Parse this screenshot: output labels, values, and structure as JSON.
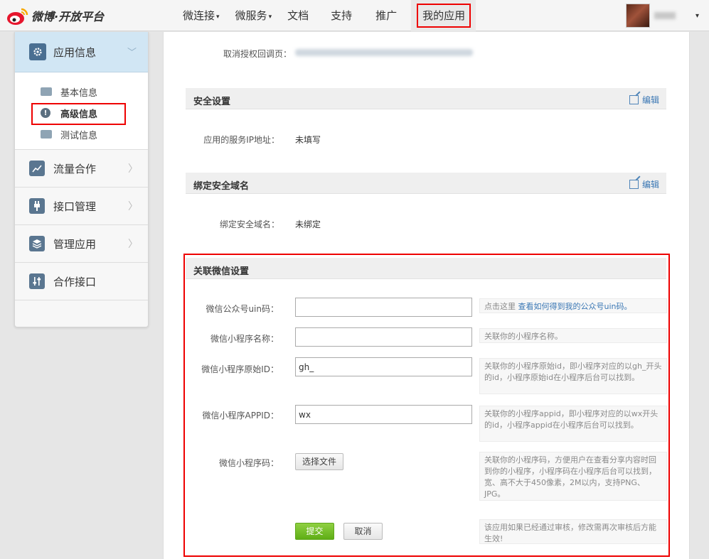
{
  "brand": {
    "logo_text": "微博·开放平台"
  },
  "nav": {
    "items": [
      {
        "label": "微连接",
        "caret": "▾"
      },
      {
        "label": "微服务",
        "caret": "▾"
      },
      {
        "label": "文档"
      },
      {
        "label": "支持"
      },
      {
        "label": "推广"
      },
      {
        "label": "我的应用"
      }
    ],
    "user_caret": "▾"
  },
  "sidebar": {
    "head": {
      "label": "应用信息",
      "icon": "gear-icon",
      "chevron": "﹀"
    },
    "sub_items": [
      {
        "label": "基本信息",
        "icon": "id-card-icon"
      },
      {
        "label": "高级信息",
        "icon": "exclamation-icon"
      },
      {
        "label": "测试信息",
        "icon": "user-card-icon"
      }
    ],
    "menu": [
      {
        "label": "流量合作",
        "icon": "line-chart-icon",
        "chevron": "〉"
      },
      {
        "label": "接口管理",
        "icon": "plug-icon",
        "chevron": "〉"
      },
      {
        "label": "管理应用",
        "icon": "layers-icon",
        "chevron": "〉"
      },
      {
        "label": "合作接口",
        "icon": "sliders-icon"
      }
    ]
  },
  "main": {
    "cancel_auth_label": "取消授权回调页：",
    "security": {
      "title": "安全设置",
      "edit": "编辑",
      "ip_label": "应用的服务IP地址：",
      "ip_value": "未填写"
    },
    "domain": {
      "title": "绑定安全域名",
      "edit": "编辑",
      "label": "绑定安全域名：",
      "value": "未绑定"
    },
    "wechat": {
      "title": "关联微信设置",
      "uin_label": "微信公众号uin码：",
      "uin_value": "",
      "uin_hint_prefix": "点击这里 ",
      "uin_hint_link": "查看如何得到我的公众号uin码。",
      "name_label": "微信小程序名称：",
      "name_value": "",
      "name_hint": "关联你的小程序名称。",
      "id_label": "微信小程序原始ID：",
      "id_value": "gh_",
      "id_hint": "关联你的小程序原始id，即小程序对应的以gh_开头的id，小程序原始id在小程序后台可以找到。",
      "appid_label": "微信小程序APPID：",
      "appid_value": "wx",
      "appid_hint": "关联你的小程序appid，即小程序对应的以wx开头的id，小程序appid在小程序后台可以找到。",
      "code_label": "微信小程序码：",
      "file_button": "选择文件",
      "code_hint": "关联你的小程序码，方便用户在查看分享内容时回到你的小程序，小程序码在小程序后台可以找到，宽、高不大于450像素，2M以内，支持PNG、JPG。",
      "submit": "提交",
      "cancel": "取消",
      "submit_hint": "该应用如果已经通过审核，修改需再次审核后方能生效!"
    }
  }
}
